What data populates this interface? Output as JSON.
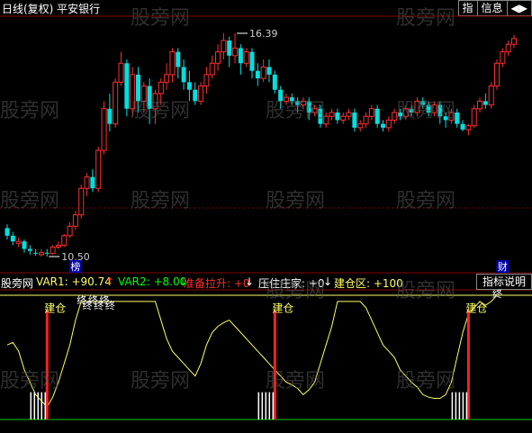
{
  "header": {
    "title": "日线(复权)  平安银行",
    "btn_index": "指",
    "btn_info": "信息",
    "btn_arrows": "◀▶"
  },
  "watermark": "股旁网",
  "colors": {
    "up": "#ff3030",
    "down": "#00e0e0",
    "ind": "#ffff66",
    "bg": "#000000",
    "grid": "#880000"
  },
  "chart_data": [
    {
      "type": "candlestick",
      "title": "",
      "ylim": [
        9.8,
        17.0
      ],
      "annotations": [
        {
          "label": "16.39",
          "index": 40,
          "value": 16.39
        },
        {
          "label": "10.50",
          "index": 7,
          "value": 10.5
        }
      ],
      "markers": [
        {
          "label": "榜",
          "index": 12
        },
        {
          "label": "财",
          "index": 87
        }
      ],
      "candles": [
        [
          11.25,
          11.05,
          11.35,
          10.95
        ],
        [
          11.05,
          10.9,
          11.15,
          10.8
        ],
        [
          10.85,
          10.9,
          11.0,
          10.75
        ],
        [
          10.9,
          10.7,
          10.95,
          10.6
        ],
        [
          10.7,
          10.65,
          10.8,
          10.55
        ],
        [
          10.6,
          10.58,
          10.7,
          10.52
        ],
        [
          10.55,
          10.6,
          10.7,
          10.5
        ],
        [
          10.6,
          10.58,
          10.7,
          10.5
        ],
        [
          10.58,
          10.75,
          10.8,
          10.55
        ],
        [
          10.75,
          10.8,
          10.9,
          10.7
        ],
        [
          10.8,
          11.05,
          11.1,
          10.75
        ],
        [
          11.05,
          11.3,
          11.4,
          11.0
        ],
        [
          11.3,
          11.6,
          11.7,
          11.2
        ],
        [
          11.6,
          12.3,
          12.4,
          11.5
        ],
        [
          12.3,
          12.6,
          12.7,
          12.1
        ],
        [
          12.6,
          12.3,
          12.8,
          12.2
        ],
        [
          12.3,
          13.3,
          13.4,
          12.2
        ],
        [
          13.3,
          14.4,
          14.6,
          13.2
        ],
        [
          14.4,
          14.0,
          14.8,
          13.8
        ],
        [
          14.0,
          15.1,
          15.2,
          13.9
        ],
        [
          15.1,
          15.6,
          15.9,
          15.0
        ],
        [
          15.6,
          14.4,
          15.7,
          14.2
        ],
        [
          14.4,
          15.3,
          15.5,
          14.2
        ],
        [
          15.3,
          14.6,
          15.5,
          14.3
        ],
        [
          14.6,
          15.0,
          15.1,
          14.3
        ],
        [
          15.0,
          14.4,
          15.2,
          14.0
        ],
        [
          14.4,
          14.8,
          14.9,
          14.0
        ],
        [
          14.8,
          15.1,
          15.2,
          14.5
        ],
        [
          15.1,
          15.3,
          15.6,
          14.9
        ],
        [
          15.3,
          15.9,
          16.0,
          15.1
        ],
        [
          15.9,
          15.5,
          16.0,
          15.2
        ],
        [
          15.5,
          15.1,
          15.7,
          14.9
        ],
        [
          15.1,
          14.9,
          15.4,
          14.6
        ],
        [
          14.9,
          14.6,
          15.1,
          14.5
        ],
        [
          14.6,
          15.0,
          15.1,
          14.5
        ],
        [
          15.0,
          15.3,
          15.5,
          14.8
        ],
        [
          15.3,
          15.6,
          15.8,
          15.2
        ],
        [
          15.6,
          15.9,
          16.1,
          15.4
        ],
        [
          15.9,
          16.2,
          16.4,
          15.7
        ],
        [
          16.2,
          15.8,
          16.3,
          15.5
        ],
        [
          15.8,
          16.0,
          16.39,
          15.6
        ],
        [
          16.0,
          15.6,
          16.1,
          15.3
        ],
        [
          15.6,
          15.9,
          16.0,
          15.5
        ],
        [
          15.9,
          15.4,
          16.0,
          15.2
        ],
        [
          15.4,
          15.2,
          15.6,
          15.0
        ],
        [
          15.2,
          15.5,
          15.7,
          15.1
        ],
        [
          15.5,
          15.3,
          15.7,
          15.1
        ],
        [
          15.3,
          14.9,
          15.4,
          14.8
        ],
        [
          14.9,
          14.6,
          15.0,
          14.4
        ],
        [
          14.6,
          14.7,
          14.8,
          14.5
        ],
        [
          14.7,
          14.6,
          14.8,
          14.5
        ],
        [
          14.6,
          14.5,
          14.7,
          14.3
        ],
        [
          14.5,
          14.6,
          14.7,
          14.4
        ],
        [
          14.6,
          14.3,
          14.7,
          14.1
        ],
        [
          14.3,
          14.4,
          14.5,
          14.2
        ],
        [
          14.4,
          14.0,
          14.5,
          13.9
        ],
        [
          14.0,
          14.2,
          14.3,
          13.9
        ],
        [
          14.2,
          14.3,
          14.4,
          14.1
        ],
        [
          14.3,
          14.1,
          14.4,
          14.0
        ],
        [
          14.1,
          14.2,
          14.3,
          14.0
        ],
        [
          14.2,
          14.3,
          14.4,
          14.1
        ],
        [
          14.3,
          13.9,
          14.4,
          13.8
        ],
        [
          13.9,
          14.0,
          14.1,
          13.8
        ],
        [
          14.0,
          14.2,
          14.3,
          13.9
        ],
        [
          14.2,
          14.4,
          14.5,
          14.1
        ],
        [
          14.4,
          14.0,
          14.5,
          13.9
        ],
        [
          14.0,
          13.9,
          14.1,
          13.8
        ],
        [
          13.9,
          14.1,
          14.2,
          13.8
        ],
        [
          14.1,
          14.3,
          14.4,
          14.0
        ],
        [
          14.3,
          14.2,
          14.4,
          14.1
        ],
        [
          14.2,
          14.4,
          14.5,
          14.1
        ],
        [
          14.4,
          14.3,
          14.5,
          14.2
        ],
        [
          14.3,
          14.6,
          14.7,
          14.2
        ],
        [
          14.6,
          14.5,
          14.7,
          14.4
        ],
        [
          14.5,
          14.3,
          14.6,
          14.2
        ],
        [
          14.3,
          14.5,
          14.6,
          14.2
        ],
        [
          14.5,
          14.2,
          14.6,
          14.0
        ],
        [
          14.2,
          14.1,
          14.3,
          13.9
        ],
        [
          14.1,
          14.3,
          14.4,
          14.0
        ],
        [
          14.3,
          14.0,
          14.4,
          13.9
        ],
        [
          14.0,
          13.85,
          14.1,
          13.8
        ],
        [
          13.85,
          13.95,
          14.0,
          13.7
        ],
        [
          13.95,
          14.4,
          14.5,
          13.9
        ],
        [
          14.4,
          14.6,
          14.7,
          14.3
        ],
        [
          14.6,
          14.5,
          14.8,
          14.4
        ],
        [
          14.5,
          15.0,
          15.1,
          14.4
        ],
        [
          15.0,
          15.6,
          15.7,
          14.9
        ],
        [
          15.6,
          15.9,
          16.0,
          15.5
        ],
        [
          15.9,
          16.1,
          16.2,
          15.8
        ],
        [
          16.1,
          16.25,
          16.35,
          16.0
        ]
      ]
    },
    {
      "type": "line",
      "title": "",
      "ylim": [
        0,
        100
      ],
      "legend": [
        {
          "label": "股旁网",
          "color": "#ffffff"
        },
        {
          "label": "VAR1: +90.74",
          "color": "#ffff66",
          "arrow": "↑",
          "arrow_color": "#ff3030"
        },
        {
          "label": "VAR2: +8.00",
          "color": "#00ff00",
          "arrow": "↓",
          "arrow_color": "#00ff00"
        },
        {
          "label": "准备拉升: +0",
          "color": "#ff3030",
          "arrow": "↓",
          "arrow_color": "#ffffff"
        },
        {
          "label": "压住庄家: +0",
          "color": "#ffffff",
          "arrow": "↓",
          "arrow_color": "#ffffff"
        },
        {
          "label": "建仓区: +100",
          "color": "#ffff66"
        }
      ],
      "ind_button": "指标说明",
      "jiancang_label": "建仓",
      "zhong_label": "终",
      "series_var1": [
        60,
        62,
        55,
        40,
        30,
        20,
        15,
        10,
        18,
        30,
        45,
        60,
        80,
        95,
        95,
        95,
        95,
        95,
        95,
        95,
        95,
        95,
        95,
        95,
        95,
        95,
        95,
        80,
        65,
        55,
        50,
        45,
        40,
        35,
        45,
        60,
        70,
        75,
        78,
        80,
        75,
        70,
        65,
        60,
        55,
        50,
        45,
        40,
        35,
        30,
        28,
        25,
        20,
        24,
        30,
        45,
        60,
        75,
        95,
        95,
        95,
        95,
        95,
        90,
        80,
        70,
        60,
        55,
        50,
        40,
        35,
        30,
        26,
        20,
        18,
        17,
        17,
        20,
        30,
        50,
        70,
        85,
        90,
        95,
        92,
        95,
        100,
        100,
        100
      ],
      "zhong_marks": [
        13,
        14,
        15,
        16,
        17,
        18,
        86
      ],
      "jiancang_marks": [
        7,
        47,
        81
      ]
    }
  ]
}
